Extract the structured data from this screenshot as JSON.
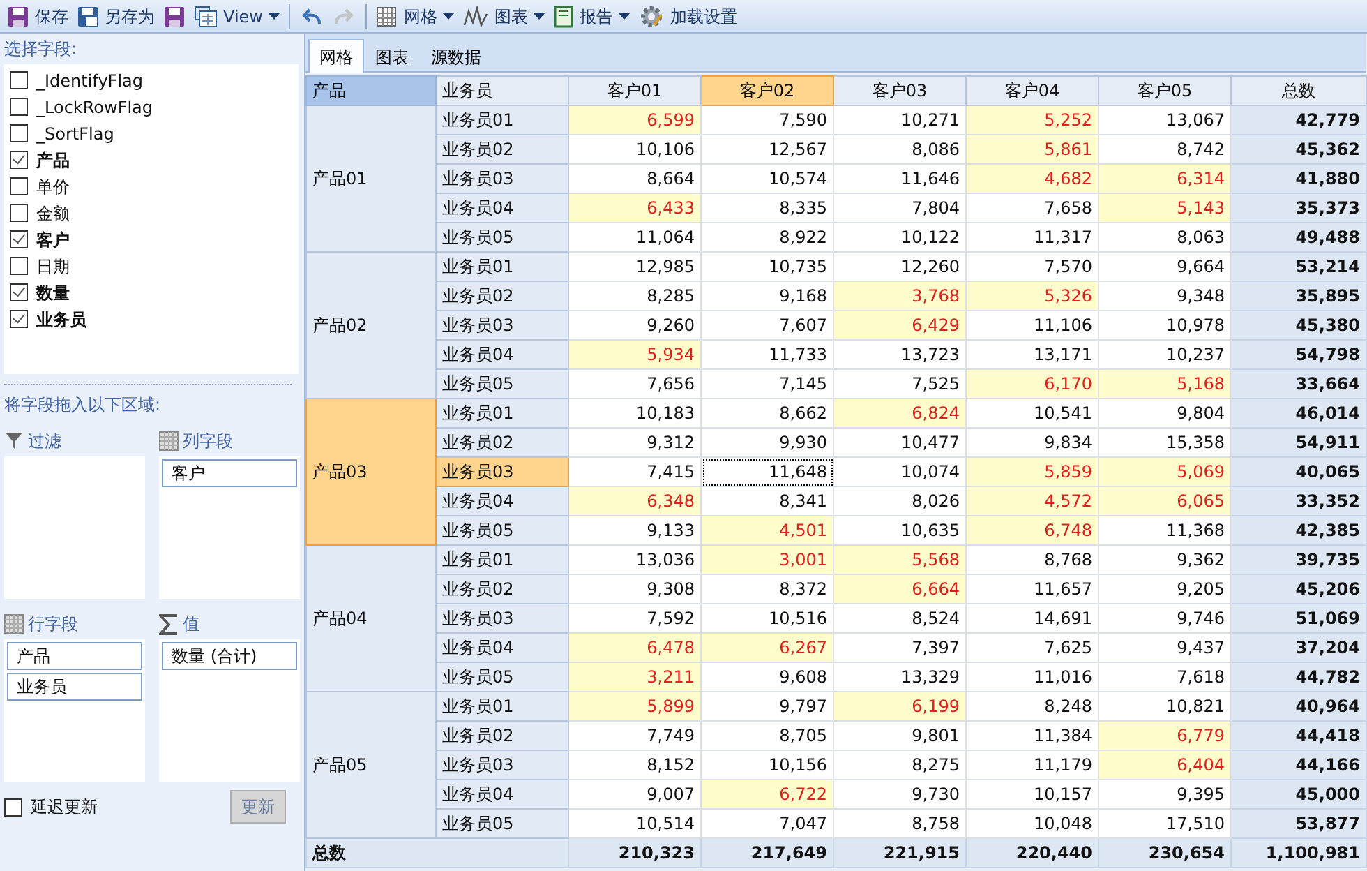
{
  "toolbar": [
    {
      "kind": "button",
      "label": "保存",
      "dropdown": false
    },
    {
      "kind": "button",
      "label": "另存为",
      "dropdown": false
    },
    {
      "kind": "icon",
      "disabled": false
    },
    {
      "kind": "button",
      "label": "View",
      "dropdown": true
    },
    {
      "kind": "separator"
    },
    {
      "kind": "icon",
      "disabled": false
    },
    {
      "kind": "icon",
      "disabled": true
    },
    {
      "kind": "separator"
    },
    {
      "kind": "button",
      "label": "网格",
      "dropdown": true
    },
    {
      "kind": "button",
      "label": "图表",
      "dropdown": true
    },
    {
      "kind": "button",
      "label": "报告",
      "dropdown": true
    },
    {
      "kind": "button",
      "label": "加载设置",
      "dropdown": false
    }
  ],
  "field_list": {
    "title": "选择字段:",
    "fields": [
      {
        "label": "_IdentifyFlag",
        "checked": false
      },
      {
        "label": "_LockRowFlag",
        "checked": false
      },
      {
        "label": "_SortFlag",
        "checked": false
      },
      {
        "label": "产品",
        "checked": true
      },
      {
        "label": "单价",
        "checked": false
      },
      {
        "label": "金额",
        "checked": false
      },
      {
        "label": "客户",
        "checked": true
      },
      {
        "label": "日期",
        "checked": false
      },
      {
        "label": "数量",
        "checked": true
      },
      {
        "label": "业务员",
        "checked": true
      }
    ]
  },
  "drop_hint": "将字段拖入以下区域:",
  "zones": [
    {
      "kind": "filter",
      "title": "过滤"
    },
    {
      "kind": "columns",
      "title": "列字段",
      "items": [
        "客户"
      ]
    },
    {
      "kind": "rows",
      "title": "行字段",
      "items": [
        "产品",
        "业务员"
      ]
    },
    {
      "kind": "values",
      "title": "值",
      "items": [
        "数量 (合计)"
      ]
    }
  ],
  "defer_update": {
    "label": "延迟更新",
    "checked": false
  },
  "update_button": {
    "label": "更新",
    "disabled": true
  },
  "tabs": [
    {
      "label": "网格",
      "selected": true
    },
    {
      "label": "图表",
      "selected": false
    },
    {
      "label": "源数据",
      "selected": false
    }
  ],
  "table": {
    "row_fields": [
      "产品",
      "业务员"
    ],
    "columns": [
      {
        "label": "客户01",
        "selected": false
      },
      {
        "label": "客户02",
        "selected": true
      },
      {
        "label": "客户03",
        "selected": false
      },
      {
        "label": "客户04",
        "selected": false
      },
      {
        "label": "客户05",
        "selected": false
      }
    ],
    "total_label": "总数",
    "groups": [
      {
        "label": "产品01",
        "selected": false,
        "rows": [
          {
            "label": "业务员01",
            "selected": false,
            "cells": [
              {
                "text": "6,599",
                "flagged": true,
                "focused": false
              },
              {
                "text": "7,590",
                "flagged": false,
                "focused": false
              },
              {
                "text": "10,271",
                "flagged": false,
                "focused": false
              },
              {
                "text": "5,252",
                "flagged": true,
                "focused": false
              },
              {
                "text": "13,067",
                "flagged": false,
                "focused": false
              }
            ],
            "total": "42,779"
          },
          {
            "label": "业务员02",
            "selected": false,
            "cells": [
              {
                "text": "10,106",
                "flagged": false,
                "focused": false
              },
              {
                "text": "12,567",
                "flagged": false,
                "focused": false
              },
              {
                "text": "8,086",
                "flagged": false,
                "focused": false
              },
              {
                "text": "5,861",
                "flagged": true,
                "focused": false
              },
              {
                "text": "8,742",
                "flagged": false,
                "focused": false
              }
            ],
            "total": "45,362"
          },
          {
            "label": "业务员03",
            "selected": false,
            "cells": [
              {
                "text": "8,664",
                "flagged": false,
                "focused": false
              },
              {
                "text": "10,574",
                "flagged": false,
                "focused": false
              },
              {
                "text": "11,646",
                "flagged": false,
                "focused": false
              },
              {
                "text": "4,682",
                "flagged": true,
                "focused": false
              },
              {
                "text": "6,314",
                "flagged": true,
                "focused": false
              }
            ],
            "total": "41,880"
          },
          {
            "label": "业务员04",
            "selected": false,
            "cells": [
              {
                "text": "6,433",
                "flagged": true,
                "focused": false
              },
              {
                "text": "8,335",
                "flagged": false,
                "focused": false
              },
              {
                "text": "7,804",
                "flagged": false,
                "focused": false
              },
              {
                "text": "7,658",
                "flagged": false,
                "focused": false
              },
              {
                "text": "5,143",
                "flagged": true,
                "focused": false
              }
            ],
            "total": "35,373"
          },
          {
            "label": "业务员05",
            "selected": false,
            "cells": [
              {
                "text": "11,064",
                "flagged": false,
                "focused": false
              },
              {
                "text": "8,922",
                "flagged": false,
                "focused": false
              },
              {
                "text": "10,122",
                "flagged": false,
                "focused": false
              },
              {
                "text": "11,317",
                "flagged": false,
                "focused": false
              },
              {
                "text": "8,063",
                "flagged": false,
                "focused": false
              }
            ],
            "total": "49,488"
          }
        ]
      },
      {
        "label": "产品02",
        "selected": false,
        "rows": [
          {
            "label": "业务员01",
            "selected": false,
            "cells": [
              {
                "text": "12,985",
                "flagged": false,
                "focused": false
              },
              {
                "text": "10,735",
                "flagged": false,
                "focused": false
              },
              {
                "text": "12,260",
                "flagged": false,
                "focused": false
              },
              {
                "text": "7,570",
                "flagged": false,
                "focused": false
              },
              {
                "text": "9,664",
                "flagged": false,
                "focused": false
              }
            ],
            "total": "53,214"
          },
          {
            "label": "业务员02",
            "selected": false,
            "cells": [
              {
                "text": "8,285",
                "flagged": false,
                "focused": false
              },
              {
                "text": "9,168",
                "flagged": false,
                "focused": false
              },
              {
                "text": "3,768",
                "flagged": true,
                "focused": false
              },
              {
                "text": "5,326",
                "flagged": true,
                "focused": false
              },
              {
                "text": "9,348",
                "flagged": false,
                "focused": false
              }
            ],
            "total": "35,895"
          },
          {
            "label": "业务员03",
            "selected": false,
            "cells": [
              {
                "text": "9,260",
                "flagged": false,
                "focused": false
              },
              {
                "text": "7,607",
                "flagged": false,
                "focused": false
              },
              {
                "text": "6,429",
                "flagged": true,
                "focused": false
              },
              {
                "text": "11,106",
                "flagged": false,
                "focused": false
              },
              {
                "text": "10,978",
                "flagged": false,
                "focused": false
              }
            ],
            "total": "45,380"
          },
          {
            "label": "业务员04",
            "selected": false,
            "cells": [
              {
                "text": "5,934",
                "flagged": true,
                "focused": false
              },
              {
                "text": "11,733",
                "flagged": false,
                "focused": false
              },
              {
                "text": "13,723",
                "flagged": false,
                "focused": false
              },
              {
                "text": "13,171",
                "flagged": false,
                "focused": false
              },
              {
                "text": "10,237",
                "flagged": false,
                "focused": false
              }
            ],
            "total": "54,798"
          },
          {
            "label": "业务员05",
            "selected": false,
            "cells": [
              {
                "text": "7,656",
                "flagged": false,
                "focused": false
              },
              {
                "text": "7,145",
                "flagged": false,
                "focused": false
              },
              {
                "text": "7,525",
                "flagged": false,
                "focused": false
              },
              {
                "text": "6,170",
                "flagged": true,
                "focused": false
              },
              {
                "text": "5,168",
                "flagged": true,
                "focused": false
              }
            ],
            "total": "33,664"
          }
        ]
      },
      {
        "label": "产品03",
        "selected": true,
        "rows": [
          {
            "label": "业务员01",
            "selected": false,
            "cells": [
              {
                "text": "10,183",
                "flagged": false,
                "focused": false
              },
              {
                "text": "8,662",
                "flagged": false,
                "focused": false
              },
              {
                "text": "6,824",
                "flagged": true,
                "focused": false
              },
              {
                "text": "10,541",
                "flagged": false,
                "focused": false
              },
              {
                "text": "9,804",
                "flagged": false,
                "focused": false
              }
            ],
            "total": "46,014"
          },
          {
            "label": "业务员02",
            "selected": false,
            "cells": [
              {
                "text": "9,312",
                "flagged": false,
                "focused": false
              },
              {
                "text": "9,930",
                "flagged": false,
                "focused": false
              },
              {
                "text": "10,477",
                "flagged": false,
                "focused": false
              },
              {
                "text": "9,834",
                "flagged": false,
                "focused": false
              },
              {
                "text": "15,358",
                "flagged": false,
                "focused": false
              }
            ],
            "total": "54,911"
          },
          {
            "label": "业务员03",
            "selected": true,
            "cells": [
              {
                "text": "7,415",
                "flagged": false,
                "focused": false
              },
              {
                "text": "11,648",
                "flagged": false,
                "focused": true
              },
              {
                "text": "10,074",
                "flagged": false,
                "focused": false
              },
              {
                "text": "5,859",
                "flagged": true,
                "focused": false
              },
              {
                "text": "5,069",
                "flagged": true,
                "focused": false
              }
            ],
            "total": "40,065"
          },
          {
            "label": "业务员04",
            "selected": false,
            "cells": [
              {
                "text": "6,348",
                "flagged": true,
                "focused": false
              },
              {
                "text": "8,341",
                "flagged": false,
                "focused": false
              },
              {
                "text": "8,026",
                "flagged": false,
                "focused": false
              },
              {
                "text": "4,572",
                "flagged": true,
                "focused": false
              },
              {
                "text": "6,065",
                "flagged": true,
                "focused": false
              }
            ],
            "total": "33,352"
          },
          {
            "label": "业务员05",
            "selected": false,
            "cells": [
              {
                "text": "9,133",
                "flagged": false,
                "focused": false
              },
              {
                "text": "4,501",
                "flagged": true,
                "focused": false
              },
              {
                "text": "10,635",
                "flagged": false,
                "focused": false
              },
              {
                "text": "6,748",
                "flagged": true,
                "focused": false
              },
              {
                "text": "11,368",
                "flagged": false,
                "focused": false
              }
            ],
            "total": "42,385"
          }
        ]
      },
      {
        "label": "产品04",
        "selected": false,
        "rows": [
          {
            "label": "业务员01",
            "selected": false,
            "cells": [
              {
                "text": "13,036",
                "flagged": false,
                "focused": false
              },
              {
                "text": "3,001",
                "flagged": true,
                "focused": false
              },
              {
                "text": "5,568",
                "flagged": true,
                "focused": false
              },
              {
                "text": "8,768",
                "flagged": false,
                "focused": false
              },
              {
                "text": "9,362",
                "flagged": false,
                "focused": false
              }
            ],
            "total": "39,735"
          },
          {
            "label": "业务员02",
            "selected": false,
            "cells": [
              {
                "text": "9,308",
                "flagged": false,
                "focused": false
              },
              {
                "text": "8,372",
                "flagged": false,
                "focused": false
              },
              {
                "text": "6,664",
                "flagged": true,
                "focused": false
              },
              {
                "text": "11,657",
                "flagged": false,
                "focused": false
              },
              {
                "text": "9,205",
                "flagged": false,
                "focused": false
              }
            ],
            "total": "45,206"
          },
          {
            "label": "业务员03",
            "selected": false,
            "cells": [
              {
                "text": "7,592",
                "flagged": false,
                "focused": false
              },
              {
                "text": "10,516",
                "flagged": false,
                "focused": false
              },
              {
                "text": "8,524",
                "flagged": false,
                "focused": false
              },
              {
                "text": "14,691",
                "flagged": false,
                "focused": false
              },
              {
                "text": "9,746",
                "flagged": false,
                "focused": false
              }
            ],
            "total": "51,069"
          },
          {
            "label": "业务员04",
            "selected": false,
            "cells": [
              {
                "text": "6,478",
                "flagged": true,
                "focused": false
              },
              {
                "text": "6,267",
                "flagged": true,
                "focused": false
              },
              {
                "text": "7,397",
                "flagged": false,
                "focused": false
              },
              {
                "text": "7,625",
                "flagged": false,
                "focused": false
              },
              {
                "text": "9,437",
                "flagged": false,
                "focused": false
              }
            ],
            "total": "37,204"
          },
          {
            "label": "业务员05",
            "selected": false,
            "cells": [
              {
                "text": "3,211",
                "flagged": true,
                "focused": false
              },
              {
                "text": "9,608",
                "flagged": false,
                "focused": false
              },
              {
                "text": "13,329",
                "flagged": false,
                "focused": false
              },
              {
                "text": "11,016",
                "flagged": false,
                "focused": false
              },
              {
                "text": "7,618",
                "flagged": false,
                "focused": false
              }
            ],
            "total": "44,782"
          }
        ]
      },
      {
        "label": "产品05",
        "selected": false,
        "rows": [
          {
            "label": "业务员01",
            "selected": false,
            "cells": [
              {
                "text": "5,899",
                "flagged": true,
                "focused": false
              },
              {
                "text": "9,797",
                "flagged": false,
                "focused": false
              },
              {
                "text": "6,199",
                "flagged": true,
                "focused": false
              },
              {
                "text": "8,248",
                "flagged": false,
                "focused": false
              },
              {
                "text": "10,821",
                "flagged": false,
                "focused": false
              }
            ],
            "total": "40,964"
          },
          {
            "label": "业务员02",
            "selected": false,
            "cells": [
              {
                "text": "7,749",
                "flagged": false,
                "focused": false
              },
              {
                "text": "8,705",
                "flagged": false,
                "focused": false
              },
              {
                "text": "9,801",
                "flagged": false,
                "focused": false
              },
              {
                "text": "11,384",
                "flagged": false,
                "focused": false
              },
              {
                "text": "6,779",
                "flagged": true,
                "focused": false
              }
            ],
            "total": "44,418"
          },
          {
            "label": "业务员03",
            "selected": false,
            "cells": [
              {
                "text": "8,152",
                "flagged": false,
                "focused": false
              },
              {
                "text": "10,156",
                "flagged": false,
                "focused": false
              },
              {
                "text": "8,275",
                "flagged": false,
                "focused": false
              },
              {
                "text": "11,179",
                "flagged": false,
                "focused": false
              },
              {
                "text": "6,404",
                "flagged": true,
                "focused": false
              }
            ],
            "total": "44,166"
          },
          {
            "label": "业务员04",
            "selected": false,
            "cells": [
              {
                "text": "9,007",
                "flagged": false,
                "focused": false
              },
              {
                "text": "6,722",
                "flagged": true,
                "focused": false
              },
              {
                "text": "9,730",
                "flagged": false,
                "focused": false
              },
              {
                "text": "10,157",
                "flagged": false,
                "focused": false
              },
              {
                "text": "9,395",
                "flagged": false,
                "focused": false
              }
            ],
            "total": "45,000"
          },
          {
            "label": "业务员05",
            "selected": false,
            "cells": [
              {
                "text": "10,514",
                "flagged": false,
                "focused": false
              },
              {
                "text": "7,047",
                "flagged": false,
                "focused": false
              },
              {
                "text": "8,758",
                "flagged": false,
                "focused": false
              },
              {
                "text": "10,048",
                "flagged": false,
                "focused": false
              },
              {
                "text": "17,510",
                "flagged": false,
                "focused": false
              }
            ],
            "total": "53,877"
          }
        ]
      }
    ],
    "grand_total": {
      "label": "总数",
      "values": [
        "210,323",
        "217,649",
        "221,915",
        "220,440",
        "230,654"
      ],
      "total": "1,100,981"
    }
  }
}
